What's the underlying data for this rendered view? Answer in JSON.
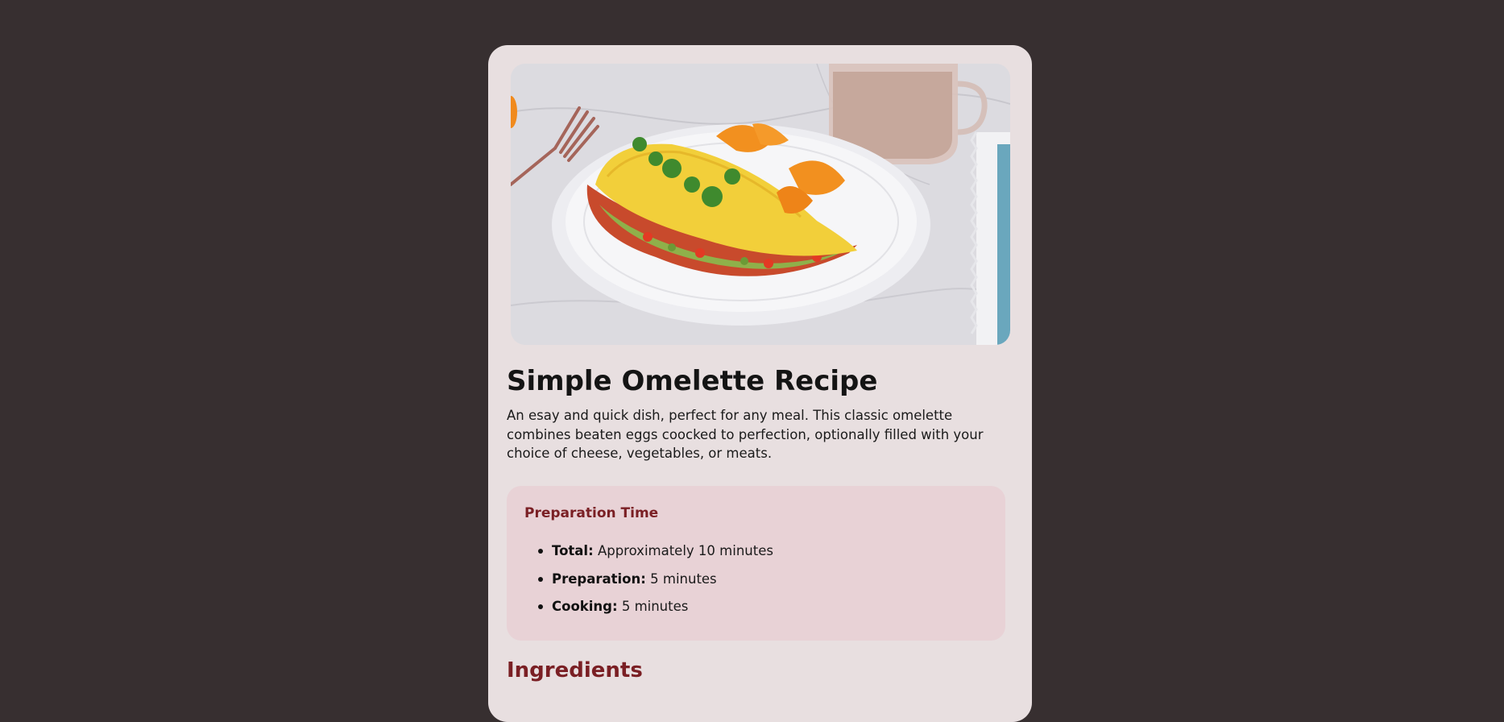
{
  "recipe": {
    "title": "Simple Omelette Recipe",
    "description": "An esay and quick dish, perfect for any meal. This classic omelette combines beaten eggs coocked to perfection, optionally filled with your choice of cheese, vegetables, or meats."
  },
  "preparation": {
    "heading": "Preparation Time",
    "items": [
      {
        "label": "Total:",
        "value": "Approximately 10 minutes"
      },
      {
        "label": "Preparation:",
        "value": "5 minutes"
      },
      {
        "label": "Cooking:",
        "value": "5 minutes"
      }
    ]
  },
  "ingredients": {
    "heading": "Ingredients"
  },
  "colors": {
    "page_background": "#372f30",
    "card_background": "#e8dfe0",
    "prep_background": "#e8d2d6",
    "accent": "#7a1f24"
  }
}
